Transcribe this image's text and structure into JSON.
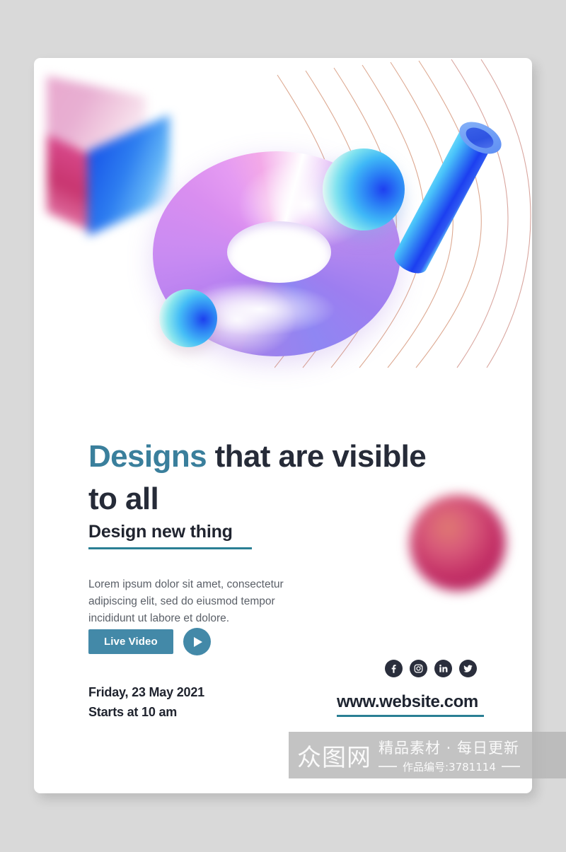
{
  "poster": {
    "headline": {
      "accent": "Designs",
      "rest": " that are visible to all"
    },
    "subtitle": "Design new thing",
    "body": [
      "Lorem ipsum dolor sit amet, consectetur",
      "adipiscing elit, sed do eiusmod tempor",
      "incididunt ut labore et dolore."
    ],
    "cta": {
      "label": "Live Video",
      "play_icon": "play-icon"
    },
    "event": {
      "date": "Friday, 23 May 2021",
      "time": "Starts at 10 am"
    },
    "social": [
      {
        "name": "facebook-icon",
        "label": "Facebook"
      },
      {
        "name": "instagram-icon",
        "label": "Instagram"
      },
      {
        "name": "linkedin-icon",
        "label": "LinkedIn"
      },
      {
        "name": "twitter-icon",
        "label": "Twitter"
      }
    ],
    "website": "www.website.com"
  },
  "colors": {
    "accent_teal": "#3a7f9c",
    "rule_teal": "#2a7f94",
    "button_teal": "#4389a8",
    "dark_navy": "#20242f",
    "body_gray": "#5b6068",
    "page_background": "#d9d9d9",
    "card_background": "#ffffff",
    "social_icon": "#2a2e3c"
  },
  "artwork": {
    "shapes": [
      "gradient-cube",
      "purple-torus",
      "blue-sphere-large",
      "blue-sphere-small",
      "blue-cylinder",
      "crimson-sphere",
      "contour-lines"
    ]
  },
  "watermark": {
    "logo": "众图网",
    "tagline": "精品素材 · 每日更新",
    "code": "作品编号:3781114"
  }
}
